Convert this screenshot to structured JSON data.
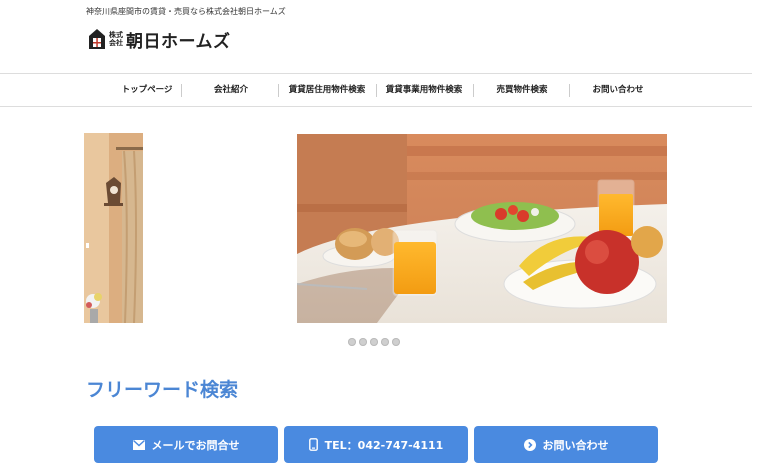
{
  "header": {
    "tagline": "神奈川県座間市の賃貸・売買なら株式会社朝日ホームズ",
    "logo_kaisha_top": "株式",
    "logo_kaisha_bottom": "会社",
    "logo_name": "朝日ホームズ"
  },
  "nav": {
    "items": [
      {
        "label": "トップページ"
      },
      {
        "label": "会社紹介"
      },
      {
        "label": "賃貸居住用物件検索"
      },
      {
        "label": "賃貸事業用物件検索"
      },
      {
        "label": "売買物件検索"
      },
      {
        "label": "お問い合わせ"
      }
    ]
  },
  "slider": {
    "dot_count": 5
  },
  "search": {
    "title": "フリーワード検索"
  },
  "cta": {
    "mail_label": "メールでお問合せ",
    "tel_label": "TEL：042-747-4111",
    "contact_label": "お問い合わせ"
  },
  "colors": {
    "accent": "#4a8ae0",
    "title_blue": "#4b86d4"
  }
}
